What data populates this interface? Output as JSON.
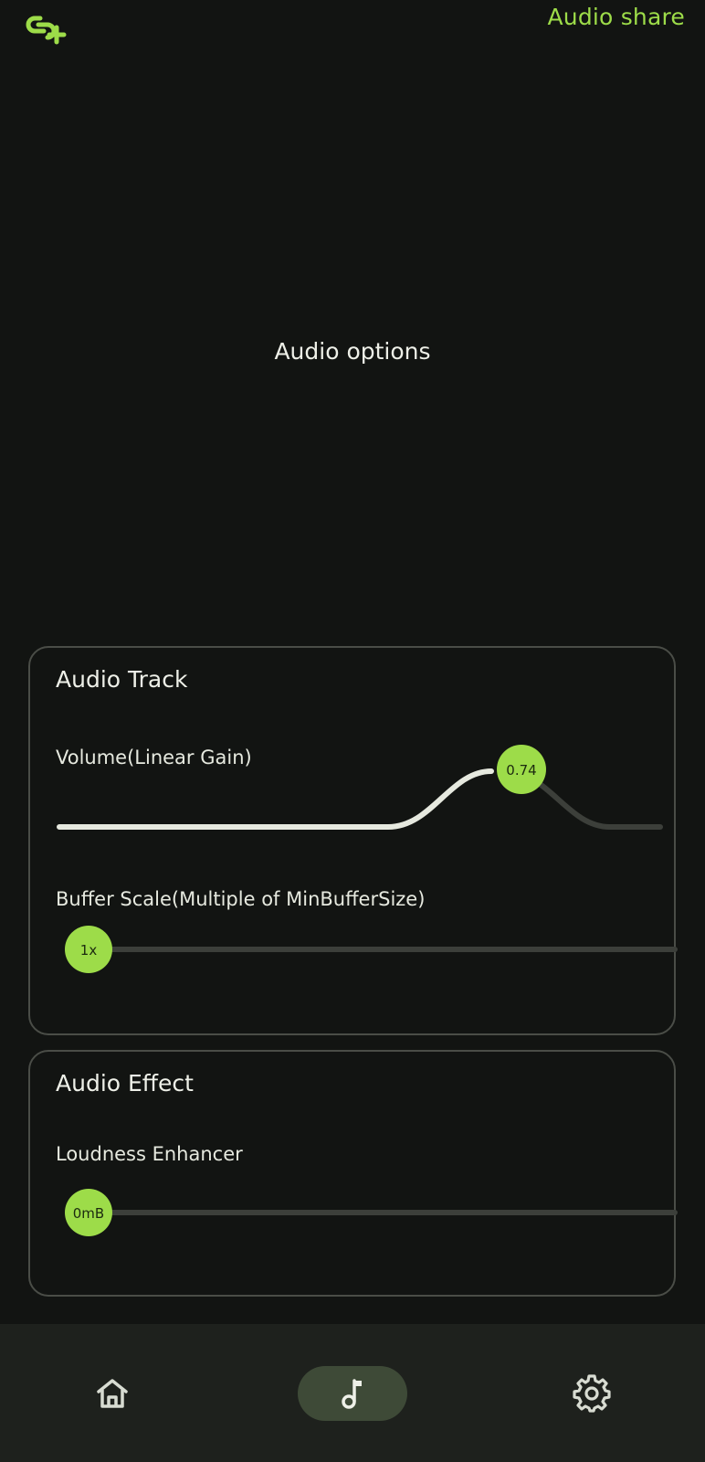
{
  "header": {
    "app_title": "Audio share",
    "logo_icon": "link-add-icon"
  },
  "page": {
    "title": "Audio options"
  },
  "audio_track": {
    "title": "Audio Track",
    "volume": {
      "label": "Volume(Linear Gain)",
      "value": 0.74,
      "value_text": "0.74",
      "min": 0,
      "max": 1
    },
    "buffer_scale": {
      "label": "Buffer Scale(Multiple of MinBufferSize)",
      "value_text": "1x",
      "fraction": 0
    }
  },
  "audio_effect": {
    "title": "Audio Effect",
    "loudness": {
      "label": "Loudness Enhancer",
      "value_text": "0mB",
      "fraction": 0
    }
  },
  "nav": {
    "items": [
      {
        "icon": "home-icon",
        "selected": false
      },
      {
        "icon": "music-note-icon",
        "selected": true
      },
      {
        "icon": "gear-icon",
        "selected": false
      }
    ]
  },
  "colors": {
    "accent": "#9ddc49",
    "background": "#121412",
    "track_inactive": "#3c3f3a",
    "track_active": "#e6e9df",
    "nav_background": "#1e211d",
    "nav_selected": "#3e4a37"
  }
}
